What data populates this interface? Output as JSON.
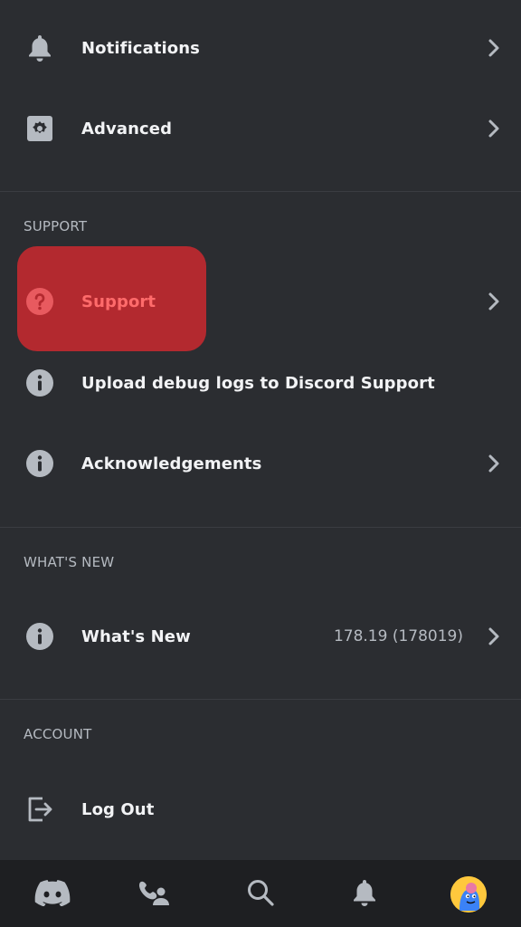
{
  "settings": {
    "notifications": {
      "label": "Notifications",
      "icon": "bell-icon"
    },
    "advanced": {
      "label": "Advanced",
      "icon": "gear-icon"
    }
  },
  "support_section": {
    "header": "SUPPORT",
    "items": [
      {
        "label": "Support",
        "icon": "question-icon",
        "highlighted": true
      },
      {
        "label": "Upload debug logs to Discord Support",
        "icon": "info-icon"
      },
      {
        "label": "Acknowledgements",
        "icon": "info-icon"
      }
    ]
  },
  "whats_new_section": {
    "header": "WHAT'S NEW",
    "item": {
      "label": "What's New",
      "value": "178.19 (178019)",
      "icon": "info-icon"
    }
  },
  "account_section": {
    "header": "ACCOUNT",
    "item": {
      "label": "Log Out",
      "icon": "logout-icon"
    }
  },
  "bottom_nav": [
    {
      "name": "home",
      "icon": "discord-icon"
    },
    {
      "name": "friends",
      "icon": "friends-icon"
    },
    {
      "name": "search",
      "icon": "search-icon"
    },
    {
      "name": "notifications",
      "icon": "bell-icon"
    },
    {
      "name": "profile",
      "icon": "avatar"
    }
  ],
  "colors": {
    "background": "#2b2d31",
    "highlight": "#b3292f",
    "support_text": "#ff6b6b",
    "nav_background": "#1e1f22"
  }
}
